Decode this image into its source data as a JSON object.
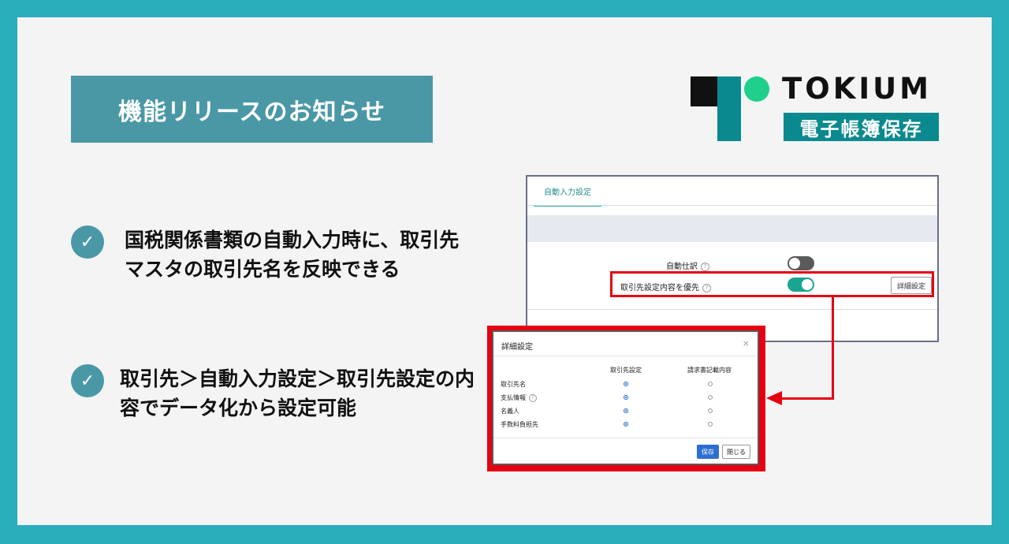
{
  "banner": {
    "title": "機能リリースのお知らせ"
  },
  "logo": {
    "word": "TOKIUM",
    "sub": "電子帳簿保存"
  },
  "bullets": [
    {
      "text": "国税関係書類の自動入力時に、取引先マスタの取引先名を反映できる"
    },
    {
      "text": "取引先＞自動入力設定＞取引先設定の内容でデータ化から設定可能"
    }
  ],
  "panel": {
    "tab_label": "自動入力設定",
    "row1_label": "自動仕訳",
    "row2_label": "取引先設定内容を優先",
    "help_glyph": "?",
    "detail_button": "詳細設定",
    "toggle_auto_journal": "off",
    "toggle_priority": "on"
  },
  "modal": {
    "title": "詳細設定",
    "close_glyph": "×",
    "col1": "取引先設定",
    "col2": "請求書記載内容",
    "rows": [
      {
        "label": "取引先名",
        "help": false,
        "selected": 1
      },
      {
        "label": "支払情報",
        "help": true,
        "selected": 1
      },
      {
        "label": "名義人",
        "help": false,
        "selected": 1
      },
      {
        "label": "手数料負担先",
        "help": false,
        "selected": 1
      }
    ],
    "save_button": "保存",
    "close_button": "閉じる"
  },
  "colors": {
    "frame": "#29aebb",
    "banner": "#4a98a6",
    "accent_red": "#e50012",
    "toggle_on": "#1aa592",
    "primary_blue": "#2d6fd1"
  }
}
